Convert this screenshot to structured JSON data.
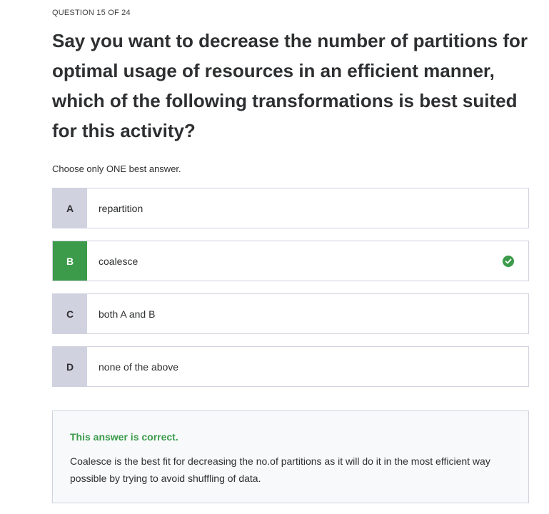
{
  "question": {
    "counter": "QUESTION 15 OF 24",
    "text": "Say you want to decrease the number of partitions for optimal usage of resources in an efficient manner, which of the following transformations is best suited for this activity?",
    "instruction": "Choose only ONE best answer."
  },
  "options": [
    {
      "letter": "A",
      "text": "repartition",
      "correct": false
    },
    {
      "letter": "B",
      "text": "coalesce",
      "correct": true
    },
    {
      "letter": "C",
      "text": "both A and B",
      "correct": false
    },
    {
      "letter": "D",
      "text": "none of the above",
      "correct": false
    }
  ],
  "feedback": {
    "title": "This answer is correct.",
    "explanation": "Coalesce is the best fit for decreasing the no.of partitions as it will do it in the most efficient way possible by trying to avoid shuffling of data."
  },
  "colors": {
    "correct": "#3b9b4a",
    "letter_bg": "#d1d2e0",
    "feedback_bg": "#f7f9fa"
  },
  "icons": {
    "correct_mark": "check-circle-icon"
  }
}
